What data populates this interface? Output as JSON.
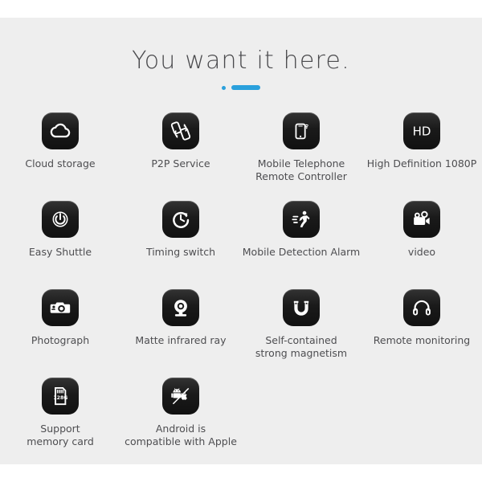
{
  "header": {
    "title": "You want it here.",
    "divider": {
      "dot_label": "divider-dot",
      "bar_label": "divider-bar",
      "color": "#2aa0dc"
    }
  },
  "theme": {
    "page_background": "#ffffff",
    "panel_background": "#eeeeee",
    "icon_tile_color": "#1c1c1c",
    "icon_glyph_color": "#ffffff",
    "title_color": "#4a4a4d",
    "label_color": "#4e4e51",
    "accent_color": "#2aa0dc"
  },
  "features": {
    "rows": [
      [
        {
          "icon": "cloud-icon",
          "label": "Cloud storage"
        },
        {
          "icon": "p2p-sync-phones-icon",
          "label": "P2P Service"
        },
        {
          "icon": "mobile-phone-signal-icon",
          "label": "Mobile Telephone\nRemote Controller"
        },
        {
          "icon": "hd-badge-icon",
          "label": "High Definition 1080P",
          "badge_text": "HD"
        }
      ],
      [
        {
          "icon": "power-button-icon",
          "label": "Easy Shuttle"
        },
        {
          "icon": "clock-timer-icon",
          "label": "Timing switch"
        },
        {
          "icon": "running-person-icon",
          "label": "Mobile Detection Alarm"
        },
        {
          "icon": "video-camera-icon",
          "label": "video"
        }
      ],
      [
        {
          "icon": "photo-camera-icon",
          "label": "Photograph"
        },
        {
          "icon": "webcam-dome-icon",
          "label": "Matte infrared ray"
        },
        {
          "icon": "magnet-icon",
          "label": "Self-contained\nstrong magnetism"
        },
        {
          "icon": "headphones-icon",
          "label": "Remote monitoring"
        }
      ],
      [
        {
          "icon": "memory-card-icon",
          "label": "Support\nmemory card",
          "badge_text": "128G"
        },
        {
          "icon": "android-apple-icon",
          "label": "Android is\ncompatible  with Apple"
        }
      ]
    ]
  }
}
